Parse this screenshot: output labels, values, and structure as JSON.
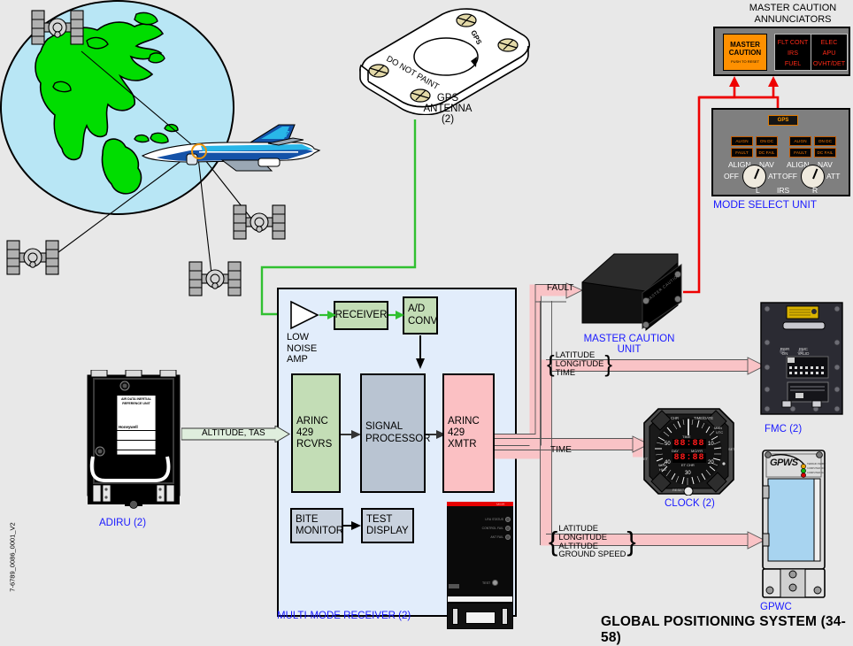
{
  "title": "GLOBAL POSITIONING SYSTEM (34-58)",
  "doc_id": "7-6789_0086_0001_V2",
  "antenna": {
    "caption_line1": "GPS",
    "caption_line2": "ANTENNA",
    "caption_line3": "(2)",
    "marking_do_not_paint": "DO  NOT  PAINT",
    "marking_gps": "GPS"
  },
  "mmr": {
    "caption": "MULTI-MODE RECEIVER (2)",
    "blocks": {
      "lna_label_l1": "LOW",
      "lna_label_l2": "NOISE",
      "lna_label_l3": "AMP",
      "receiver": "RECEIVER",
      "ad_conv_l1": "A/D",
      "ad_conv_l2": "CONV",
      "arinc_rcvrs_l1": "ARINC 429",
      "arinc_rcvrs_l2": "RCVRS",
      "signal_proc_l1": "SIGNAL",
      "signal_proc_l2": "PROCESSOR",
      "arinc_xmtr_l1": "ARINC 429",
      "arinc_xmtr_l2": "XMTR",
      "bite_l1": "BITE",
      "bite_l2": "MONITOR",
      "test_l1": "TEST",
      "test_l2": "DISPLAY"
    },
    "unit_leds": [
      "LRU STATUS",
      "CONTROL FAIL",
      "ANT FAIL"
    ],
    "unit_test": "TEST",
    "unit_top_label": "MMR"
  },
  "adiru": {
    "caption": "ADIRU (2)",
    "plate_l1": "AIR  DATA  INERTIAL",
    "plate_l2": "REFERENCE  UNIT",
    "brand": "Honeywell"
  },
  "signals": {
    "altitude_tas": "ALTITUDE, TAS",
    "fault": "FAULT",
    "time": "TIME",
    "group_a": [
      "LATITUDE",
      "LONGITUDE",
      "TIME"
    ],
    "group_b": [
      "LATITUDE",
      "LONGITUDE",
      "ALTITUDE",
      "GROUND SPEED"
    ]
  },
  "master_caution_unit": {
    "caption_l1": "MASTER CAUTION",
    "caption_l2": "UNIT",
    "face_text": "MASTER CAUTION"
  },
  "master_caution_annunciators": {
    "title_l1": "MASTER CAUTION",
    "title_l2": "ANNUNCIATORS",
    "master_caution_l1": "MASTER",
    "master_caution_l2": "CAUTION",
    "master_caution_sub": "PUSH TO RESET",
    "left_column": [
      "FLT CONT",
      "IRS",
      "FUEL"
    ],
    "right_column": [
      "ELEC",
      "APU",
      "OVHT/DET"
    ]
  },
  "mode_select_unit": {
    "caption": "MODE SELECT UNIT",
    "gps_button": "GPS",
    "annunciators": [
      "ALIGN",
      "ON DC",
      "FAULT",
      "DC FAIL"
    ],
    "knob_labels": [
      "ALIGN",
      "NAV",
      "OFF",
      "ATT"
    ],
    "bottom_left": "L",
    "bottom_center": "IRS",
    "bottom_right": "R"
  },
  "fmc": {
    "caption": "FMC (2)",
    "led_pwr_l1": "PWR",
    "led_pwr_l2": "ON",
    "led_valid_l1": "FMC",
    "led_valid_l2": "VALID"
  },
  "clock": {
    "caption": "CLOCK (2)",
    "chr": "CHR",
    "time_date": "TIME/DATE",
    "man": "MAN",
    "utc": "UTC",
    "set": "SET",
    "et": "ET",
    "run": "RUN",
    "hld": "HLD",
    "time": "TIME",
    "day": "DAY",
    "mo_yr": "MO/YR",
    "et_chr": "ET CHR",
    "reset": "RESET",
    "display_top": "88:88",
    "display_bottom": "88:88",
    "dial_ticks": [
      "50",
      "40",
      "30",
      "20",
      "10"
    ]
  },
  "gpwc": {
    "caption": "GPWC",
    "brand": "GPWS",
    "leds": [
      "TERRAIN INHIBIT",
      "COMPUTER ON",
      "COMPUTER FAIL"
    ]
  },
  "colors": {
    "mmr_fill": "#e2edfb",
    "green_block": "#c3ddb6",
    "grey_block": "#b9c4d2",
    "pink_block": "#fbc0c3",
    "pipe": "#f9c3c6",
    "green_line": "#30c030",
    "red_line": "#ee0000",
    "caption_blue": "#1a1aff",
    "annunciator_amber": "#ff7a00",
    "annunciator_red": "#ff2a17",
    "globe_ocean": "#b8e6f5",
    "globe_land": "#00dd00"
  }
}
